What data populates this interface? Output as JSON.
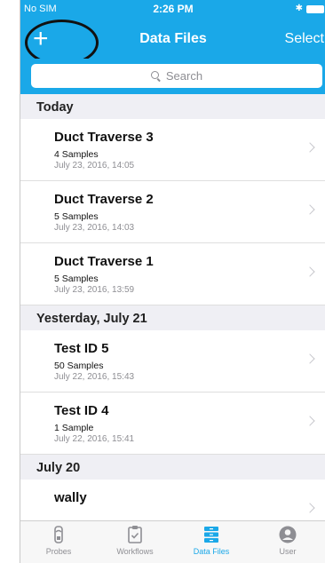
{
  "status_bar": {
    "carrier": "No SIM",
    "time": "2:26 PM"
  },
  "nav": {
    "add_label": "+",
    "title": "Data Files",
    "select_label": "Select"
  },
  "search": {
    "placeholder": "Search"
  },
  "sections": [
    {
      "header": "Today",
      "items": [
        {
          "title": "Duct Traverse 3",
          "samples": "4 Samples",
          "date": "July 23, 2016, 14:05"
        },
        {
          "title": "Duct Traverse 2",
          "samples": "5 Samples",
          "date": "July 23, 2016, 14:03"
        },
        {
          "title": "Duct Traverse 1",
          "samples": "5 Samples",
          "date": "July 23, 2016, 13:59"
        }
      ]
    },
    {
      "header": "Yesterday, July 21",
      "items": [
        {
          "title": "Test ID 5",
          "samples": "50 Samples",
          "date": "July 22, 2016, 15:43"
        },
        {
          "title": "Test ID 4",
          "samples": "1 Sample",
          "date": "July 22, 2016, 15:41"
        }
      ]
    },
    {
      "header": "July 20",
      "items": [
        {
          "title": "wally",
          "samples": "",
          "date": ""
        }
      ]
    }
  ],
  "tabs": [
    {
      "label": "Probes",
      "icon": "probe-icon",
      "active": false
    },
    {
      "label": "Workflows",
      "icon": "clipboard-check-icon",
      "active": false
    },
    {
      "label": "Data Files",
      "icon": "file-cabinet-icon",
      "active": true
    },
    {
      "label": "User",
      "icon": "user-icon",
      "active": false
    }
  ],
  "colors": {
    "accent": "#1aa8e8",
    "background": "#efeff4"
  }
}
